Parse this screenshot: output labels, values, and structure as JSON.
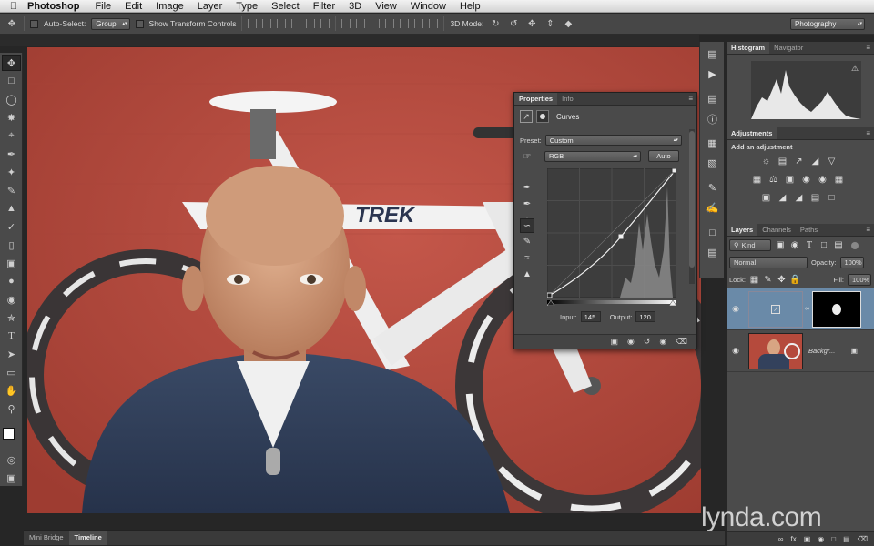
{
  "menubar": {
    "app_name": "Photoshop",
    "items": [
      "File",
      "Edit",
      "Image",
      "Layer",
      "Type",
      "Select",
      "Filter",
      "3D",
      "View",
      "Window",
      "Help"
    ]
  },
  "options": {
    "auto_select_label": "Auto-Select:",
    "auto_select_target": "Group",
    "show_transform_label": "Show Transform Controls",
    "mode_3d_label": "3D Mode:",
    "workspace": "Photography"
  },
  "panels": {
    "histogram_tabs": [
      "Histogram",
      "Navigator"
    ],
    "adjustments_tab": "Adjustments",
    "adjustments_hint": "Add an adjustment",
    "layers_tabs": [
      "Layers",
      "Channels",
      "Paths"
    ],
    "filter_kind": "Kind",
    "blend_mode": "Normal",
    "opacity_label": "Opacity:",
    "opacity_value": "100%",
    "lock_label": "Lock:",
    "fill_label": "Fill:",
    "fill_value": "100%",
    "background_layer_name": "Backgr..."
  },
  "properties": {
    "tabs": [
      "Properties",
      "Info"
    ],
    "title": "Curves",
    "preset_label": "Preset:",
    "preset_value": "Custom",
    "channel_value": "RGB",
    "auto_label": "Auto",
    "input_label": "Input:",
    "input_value": "145",
    "output_label": "Output:",
    "output_value": "120"
  },
  "bottom_tabs": [
    "Mini Bridge",
    "Timeline"
  ],
  "watermark": "lynda.com",
  "colors": {
    "ui_dark": "#474747",
    "panel": "#4a4a4a",
    "selected_layer": "#6a8aa8",
    "wall_red": "#b54a3c"
  }
}
